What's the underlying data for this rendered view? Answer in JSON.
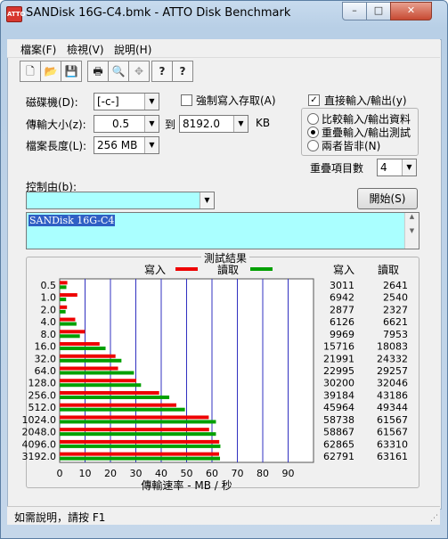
{
  "window": {
    "title": "SANDisk 16G-C4.bmk - ATTO Disk Benchmark",
    "min": "–",
    "max": "□",
    "close": "✕"
  },
  "menu": [
    "檔案(F)",
    "檢視(V)",
    "說明(H)"
  ],
  "toolbar": [
    {
      "name": "new-file-icon",
      "glyph": "🗋"
    },
    {
      "name": "open-folder-icon",
      "glyph": "📂"
    },
    {
      "name": "save-icon",
      "glyph": "💾"
    },
    {
      "name": "print-icon",
      "glyph": "🖶"
    },
    {
      "name": "print-preview-icon",
      "glyph": "🔍"
    },
    {
      "name": "move-icon",
      "glyph": "✥"
    },
    {
      "name": "help-icon",
      "glyph": "?"
    },
    {
      "name": "context-help-icon",
      "glyph": "?"
    }
  ],
  "settings": {
    "drive_label": "磁碟機(D):",
    "drive_value": "[-c-]",
    "force_write_label": "強制寫入存取(A)",
    "force_write_checked": false,
    "direct_io_label": "直接輸入/輸出(y)",
    "direct_io_checked": true,
    "transfer_size_label": "傳輸大小(z):",
    "transfer_from": "0.5",
    "to_label": "到",
    "transfer_to": "8192.0",
    "unit": "KB",
    "file_length_label": "檔案長度(L):",
    "file_length_value": "256 MB",
    "io_options": [
      {
        "label": "比較輸入/輸出資料",
        "selected": false
      },
      {
        "label": "重疊輸入/輸出測試",
        "selected": true
      },
      {
        "label": "兩者皆非(N)",
        "selected": false
      }
    ],
    "queue_label": "重疊項目數",
    "queue_value": "4",
    "controlled_by_label": "控制由(b):",
    "controlled_by_value": "",
    "start_button": "開始(S)",
    "description": "SANDisk 16G-C4"
  },
  "results": {
    "title": "測試結果",
    "write_label": "寫入",
    "read_label": "讀取",
    "write_color": "#ee0000",
    "read_color": "#00a000"
  },
  "status": "如需說明，請按 F1",
  "chart_data": {
    "type": "bar",
    "orientation": "horizontal",
    "categories": [
      "0.5",
      "1.0",
      "2.0",
      "4.0",
      "8.0",
      "16.0",
      "32.0",
      "64.0",
      "128.0",
      "256.0",
      "512.0",
      "1024.0",
      "2048.0",
      "4096.0",
      "3192.0"
    ],
    "series": [
      {
        "name": "寫入",
        "values": [
          3011,
          6942,
          2877,
          6126,
          9969,
          15716,
          21991,
          22995,
          30200,
          39184,
          45964,
          58738,
          58867,
          62865,
          62791
        ]
      },
      {
        "name": "讀取",
        "values": [
          2641,
          2540,
          2327,
          6621,
          7953,
          18083,
          24332,
          29257,
          32046,
          43186,
          49344,
          61567,
          61567,
          63310,
          63161
        ]
      }
    ],
    "xlabel": "傳輸速率 - MB / 秒",
    "xticks": [
      "0",
      "10",
      "20",
      "30",
      "40",
      "50",
      "60",
      "70",
      "80",
      "90"
    ],
    "xlim": [
      0,
      100
    ],
    "units": "KB/s",
    "grid": true,
    "legend": "top-center"
  }
}
